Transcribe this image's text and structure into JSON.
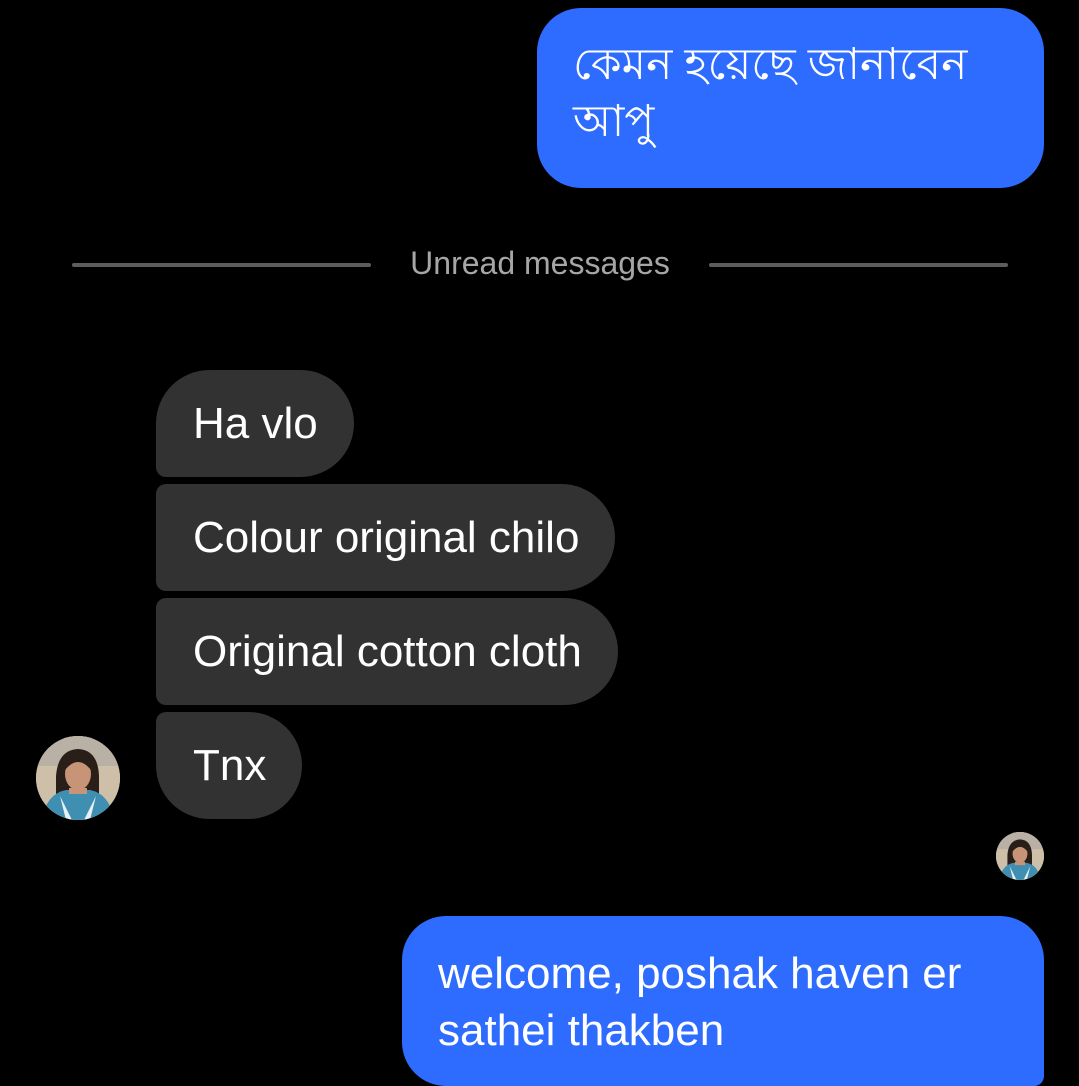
{
  "messages": {
    "outgoing_top": {
      "line1": "কেমন হয়েছে জানাবেন",
      "line2": "আপু"
    },
    "unread_divider": "Unread messages",
    "incoming": [
      {
        "text": "Ha vlo"
      },
      {
        "text": "Colour original chilo"
      },
      {
        "text": "Original cotton cloth"
      },
      {
        "text": "Tnx"
      }
    ],
    "outgoing_bottom": {
      "line1": "welcome,  poshak haven er",
      "line2": "sathei thakben"
    }
  },
  "avatars": {
    "sender_icon": "user-photo-avatar",
    "seen_icon": "seen-receipt-avatar"
  },
  "colors": {
    "background": "#000000",
    "outgoing_bubble": "#2e6cff",
    "incoming_bubble": "#323232",
    "divider_text": "#a6a6a6",
    "divider_line": "#5d5d5d"
  }
}
